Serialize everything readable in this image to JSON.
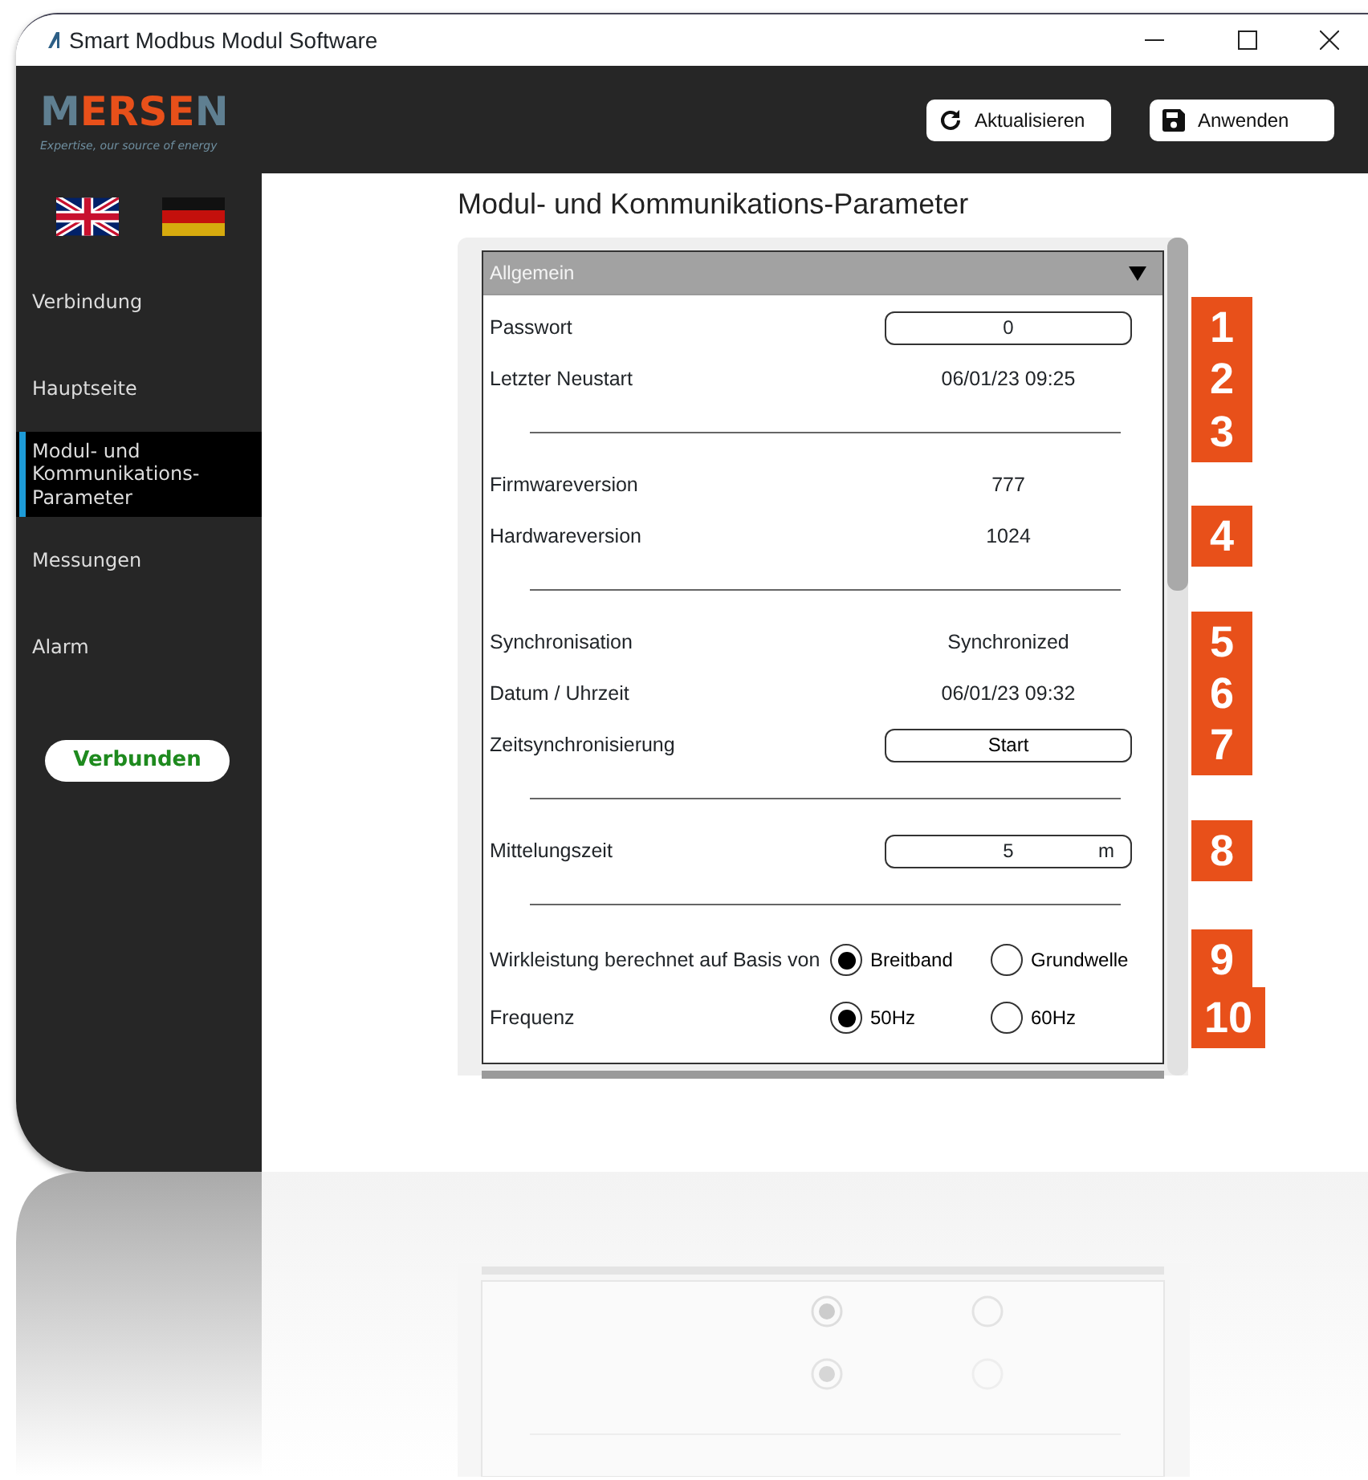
{
  "window": {
    "title": "Smart Modbus Modul Software"
  },
  "header": {
    "logo": {
      "word_parts": [
        "M",
        "ERSE",
        "N"
      ],
      "tagline": "Expertise, our source of energy"
    },
    "buttons": [
      {
        "kind": "refresh",
        "label": "Aktualisieren"
      },
      {
        "kind": "save",
        "label": "Anwenden"
      }
    ]
  },
  "sidebar": {
    "languages": [
      {
        "kind": "uk"
      },
      {
        "kind": "de"
      }
    ],
    "items": [
      {
        "label": "Verbindung",
        "selected": false
      },
      {
        "label": "Hauptseite",
        "selected": false
      },
      {
        "label": "Modul- und Kommunikations-Parameter",
        "selected": true
      },
      {
        "label": "Messungen",
        "selected": false
      },
      {
        "label": "Alarm",
        "selected": false
      }
    ],
    "status": "Verbunden"
  },
  "page_title": "Modul- und Kommunikations-Parameter",
  "section": {
    "title": "Allgemein",
    "expanded": true,
    "rows": [
      {
        "kind": "input",
        "label": "Passwort",
        "value": "0",
        "marker": "1"
      },
      {
        "kind": "value",
        "label": "Letzter Neustart",
        "value": "06/01/23 09:25",
        "marker": "2"
      },
      {
        "kind": "divider",
        "marker": "3"
      },
      {
        "kind": "value",
        "label": "Firmwareversion",
        "value": "777"
      },
      {
        "kind": "value",
        "label": "Hardwareversion",
        "value": "1024",
        "marker": "4"
      },
      {
        "kind": "divider"
      },
      {
        "kind": "value",
        "label": "Synchronisation",
        "value": "Synchronized",
        "marker": "5"
      },
      {
        "kind": "value",
        "label": "Datum / Uhrzeit",
        "value": "06/01/23 09:32",
        "marker": "6"
      },
      {
        "kind": "button",
        "label": "Zeitsynchronisierung",
        "value": "Start",
        "marker": "7"
      },
      {
        "kind": "divider"
      },
      {
        "kind": "input",
        "label": "Mittelungszeit",
        "value": "5",
        "unit": "m",
        "marker": "8"
      },
      {
        "kind": "divider"
      },
      {
        "kind": "radio",
        "label": "Wirkleistung berechnet auf Basis von",
        "options": [
          {
            "label": "Breitband",
            "selected": true
          },
          {
            "label": "Grundwelle",
            "selected": false
          }
        ],
        "marker": "9"
      },
      {
        "kind": "radio",
        "label": "Frequenz",
        "options": [
          {
            "label": "50Hz",
            "selected": true
          },
          {
            "label": "60Hz",
            "selected": false
          }
        ],
        "marker": "10"
      }
    ]
  }
}
